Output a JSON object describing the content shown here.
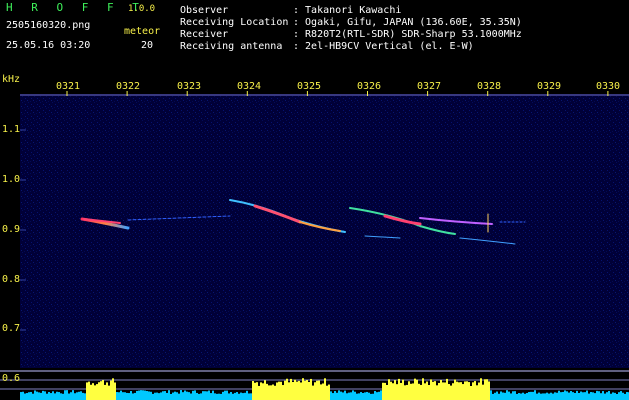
{
  "header": {
    "app_title": "H R O F F T",
    "version": "1.0.0",
    "filename": "2505160320.png",
    "datetime": "25.05.16 03:20",
    "meteor_label": "meteor",
    "meteor_count": "20"
  },
  "info": {
    "observer_key": "Observer",
    "observer_val": ": Takanori Kawachi",
    "location_key": "Receiving Location",
    "location_val": ": Ogaki, Gifu, JAPAN (136.60E, 35.35N)",
    "receiver_key": "Receiver",
    "receiver_val": ": R820T2(RTL-SDR) SDR-Sharp 53.1000MHz",
    "antenna_key": "Receiving antenna",
    "antenna_val": ": 2el-HB9CV Vertical (el. E-W)"
  },
  "axis": {
    "unit": "kHz",
    "time_ticks": [
      "0321",
      "0322",
      "0323",
      "0324",
      "0325",
      "0326",
      "0327",
      "0328",
      "0329",
      "0330"
    ],
    "freq_ticks": [
      "1.1",
      "1.0",
      "0.9",
      "0.8",
      "0.7",
      "0.6"
    ]
  },
  "colors": {
    "background": "#00003a",
    "label": "#f7f04a",
    "title": "#3ef05a",
    "signal_high": "#ff4060",
    "signal_mid": "#40c0ff",
    "noise_bar": "#00c8ff",
    "noise_peak": "#ffff40"
  }
}
